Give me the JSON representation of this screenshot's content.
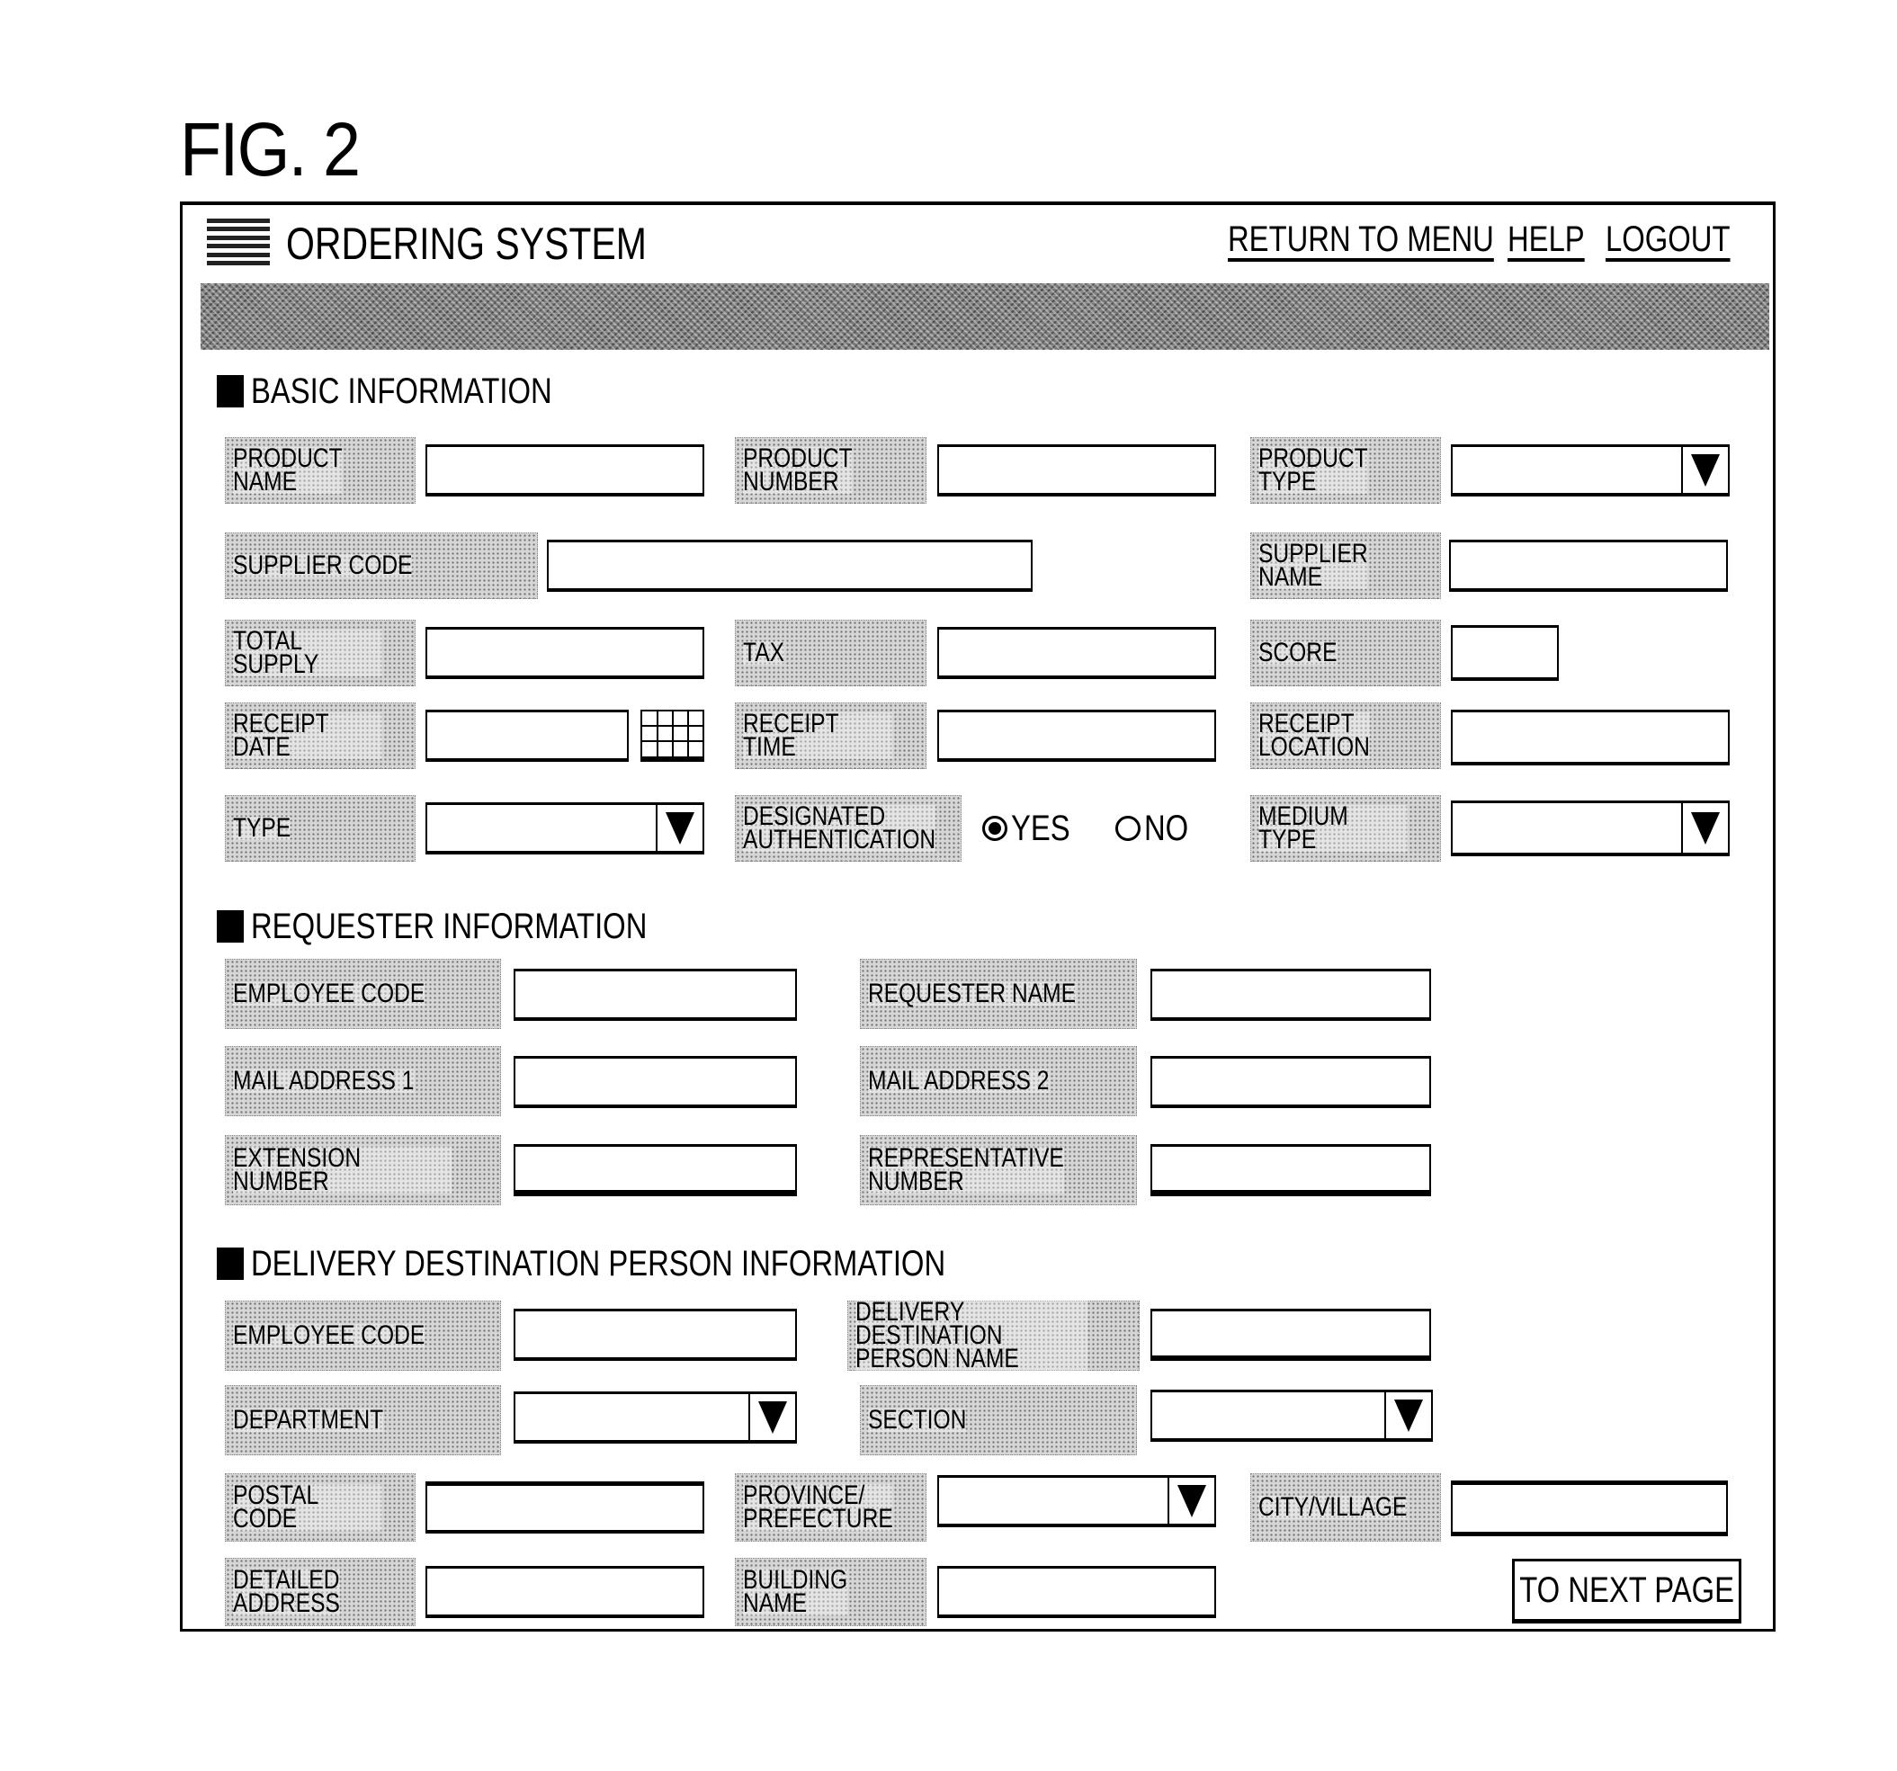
{
  "figure_label": "FIG. 2",
  "header": {
    "title": "ORDERING SYSTEM",
    "menu_icon": "hamburger-menu-icon",
    "links": {
      "return_to_menu": "RETURN TO MENU",
      "help": "HELP",
      "logout": "LOGOUT"
    }
  },
  "sections": {
    "basic": {
      "title": "BASIC INFORMATION",
      "product_name": {
        "label": "PRODUCT\nNAME",
        "value": ""
      },
      "product_number": {
        "label": "PRODUCT\nNUMBER",
        "value": ""
      },
      "product_type": {
        "label": "PRODUCT\nTYPE",
        "value": ""
      },
      "supplier_code": {
        "label": "SUPPLIER CODE",
        "value": ""
      },
      "supplier_name": {
        "label": "SUPPLIER\nNAME",
        "value": ""
      },
      "total_supply": {
        "label": "TOTAL SUPPLY",
        "value": ""
      },
      "tax": {
        "label": "TAX",
        "value": ""
      },
      "score": {
        "label": "SCORE",
        "value": ""
      },
      "receipt_date": {
        "label": "RECEIPT DATE",
        "value": "",
        "icon": "calendar-icon"
      },
      "receipt_time": {
        "label": "RECEIPT TIME",
        "value": ""
      },
      "receipt_location": {
        "label": "RECEIPT\nLOCATION",
        "value": ""
      },
      "type": {
        "label": "TYPE",
        "value": ""
      },
      "designated_authentication": {
        "label": "DESIGNATED\nAUTHENTICATION",
        "options": [
          {
            "label": "YES",
            "selected": true
          },
          {
            "label": "NO",
            "selected": false
          }
        ]
      },
      "medium_type": {
        "label": "MEDIUM TYPE",
        "value": ""
      }
    },
    "requester": {
      "title": "REQUESTER INFORMATION",
      "employee_code": {
        "label": "EMPLOYEE CODE",
        "value": ""
      },
      "requester_name": {
        "label": "REQUESTER NAME",
        "value": ""
      },
      "mail_address_1": {
        "label": "MAIL ADDRESS 1",
        "value": ""
      },
      "mail_address_2": {
        "label": "MAIL ADDRESS 2",
        "value": ""
      },
      "extension_number": {
        "label": "EXTENSION NUMBER",
        "value": ""
      },
      "representative_number": {
        "label": "REPRESENTATIVE\nNUMBER",
        "value": ""
      }
    },
    "delivery": {
      "title": "DELIVERY DESTINATION PERSON INFORMATION",
      "employee_code": {
        "label": "EMPLOYEE CODE",
        "value": ""
      },
      "person_name": {
        "label": "DELIVERY DESTINATION\nPERSON NAME",
        "value": ""
      },
      "department": {
        "label": "DEPARTMENT",
        "value": ""
      },
      "section": {
        "label": "SECTION",
        "value": ""
      },
      "postal_code": {
        "label": "POSTAL CODE",
        "value": ""
      },
      "province": {
        "label": "PROVINCE/\nPREFECTURE",
        "value": ""
      },
      "city": {
        "label": "CITY/VILLAGE",
        "value": ""
      },
      "detailed_address": {
        "label": "DETAILED\nADDRESS",
        "value": ""
      },
      "building_name": {
        "label": "BUILDING\nNAME",
        "value": ""
      }
    }
  },
  "footer": {
    "next_page_label": "TO NEXT PAGE"
  }
}
